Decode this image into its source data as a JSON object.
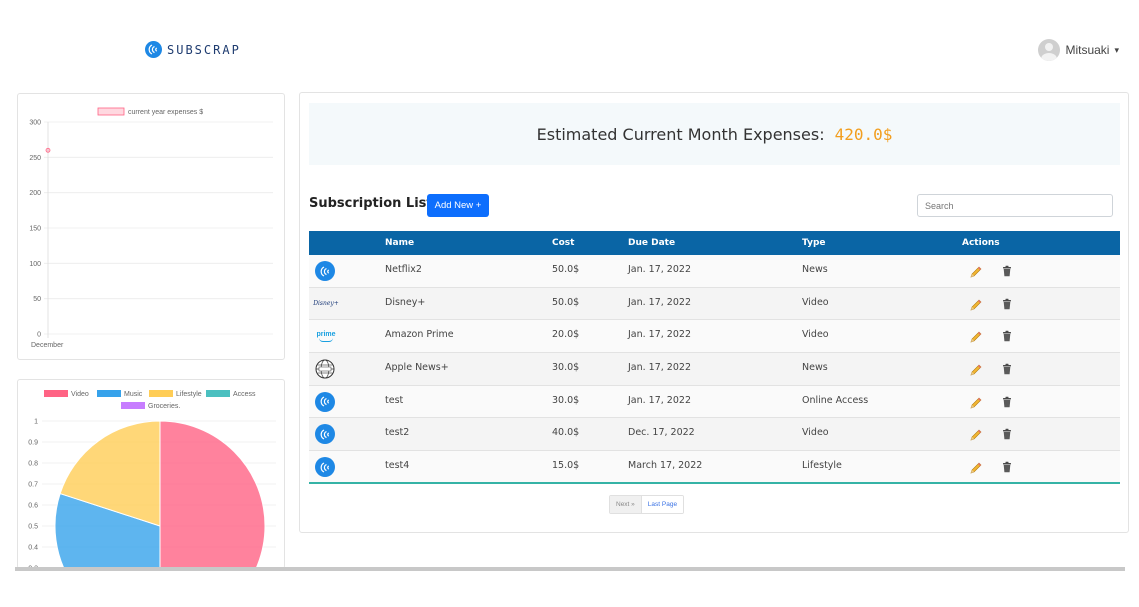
{
  "nav": {
    "brand": "SUBSCRAP",
    "user_name": "Mitsuaki",
    "caret": "▾"
  },
  "line_chart": {
    "chart_data": {
      "type": "line",
      "categories": [
        "December"
      ],
      "series": [
        {
          "name": "current year expenses $",
          "values": [
            260
          ]
        }
      ],
      "ylim": [
        0,
        300
      ],
      "yticks": [
        0,
        50,
        100,
        150,
        200,
        250,
        300
      ],
      "grid": true,
      "legend": "top",
      "color": "#ff6384"
    }
  },
  "pie_chart": {
    "chart_data": {
      "type": "pie",
      "legend": "top",
      "labels": [
        "Video",
        "Music",
        "Lifestyle",
        "Access",
        "Groceries."
      ],
      "colors": [
        "#ff6384",
        "#36a2eb",
        "#ffcd56",
        "#4bc0c0",
        "#c77dff"
      ],
      "values": [
        50,
        30,
        20,
        0,
        0
      ],
      "yticks": [
        "1",
        "0.9",
        "0.8",
        "0.7",
        "0.6",
        "0.5",
        "0.4",
        "0.3"
      ]
    }
  },
  "banner": {
    "label": "Estimated Current Month Expenses:",
    "value": "420.0$"
  },
  "list": {
    "title": "Subscription List",
    "add_button": "Add New +",
    "search_placeholder": "Search",
    "headers": {
      "name": "Name",
      "cost": "Cost",
      "due": "Due Date",
      "type": "Type",
      "actions": "Actions"
    },
    "rows": [
      {
        "logo": "subscrap-logo",
        "name": "Netflix2",
        "cost": "50.0$",
        "due": "Jan. 17, 2022",
        "type": "News"
      },
      {
        "logo": "disney-logo",
        "name": "Disney+",
        "cost": "50.0$",
        "due": "Jan. 17, 2022",
        "type": "Video"
      },
      {
        "logo": "prime-logo",
        "name": "Amazon Prime",
        "cost": "20.0$",
        "due": "Jan. 17, 2022",
        "type": "Video"
      },
      {
        "logo": "news-globe-logo",
        "name": "Apple News+",
        "cost": "30.0$",
        "due": "Jan. 17, 2022",
        "type": "News"
      },
      {
        "logo": "subscrap-logo",
        "name": "test",
        "cost": "30.0$",
        "due": "Jan. 17, 2022",
        "type": "Online Access"
      },
      {
        "logo": "subscrap-logo",
        "name": "test2",
        "cost": "40.0$",
        "due": "Dec. 17, 2022",
        "type": "Video"
      },
      {
        "logo": "subscrap-logo",
        "name": "test4",
        "cost": "15.0$",
        "due": "March 17, 2022",
        "type": "Lifestyle"
      }
    ],
    "logo_texts": {
      "disney": "Disney+",
      "prime": "prime"
    }
  },
  "pager": {
    "next": "Next »",
    "last": "Last Page"
  }
}
